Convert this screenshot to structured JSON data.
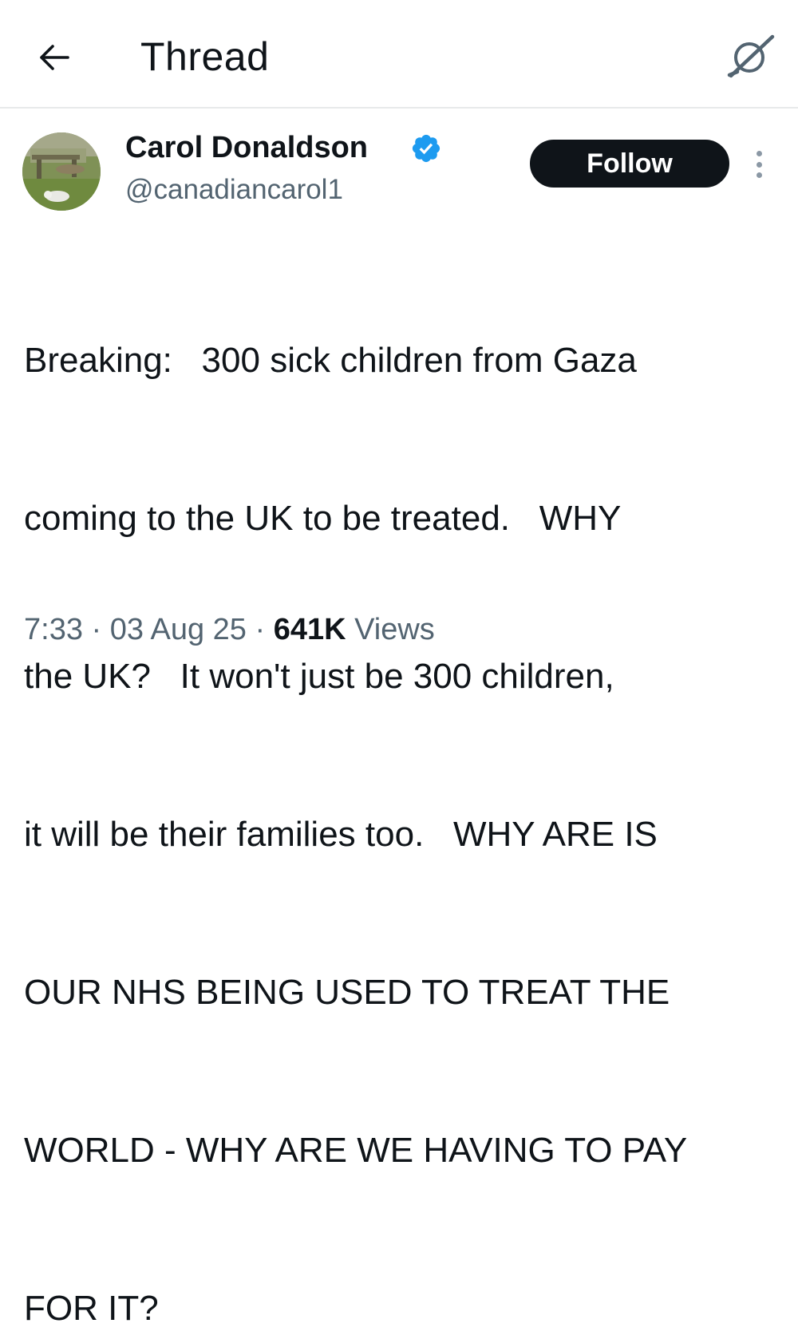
{
  "header": {
    "title": "Thread",
    "back_icon": "arrow-left-icon",
    "grok_icon": "grok-icon"
  },
  "tweet": {
    "author": {
      "display_name": "Carol Donaldson",
      "handle": "@canadiancarol1",
      "verified": true,
      "verified_color": "#1d9bf0"
    },
    "follow_label": "Follow",
    "text_lines": [
      "Breaking:   300 sick children from Gaza",
      "coming to the UK to be treated.   WHY",
      "the UK?   It won't just be 300 children,",
      "it will be their families too.   WHY ARE IS",
      "OUR NHS BEING USED TO TREAT THE",
      "WORLD - WHY ARE WE HAVING TO PAY",
      "FOR IT?"
    ],
    "time": "7:33",
    "separator": " · ",
    "date": "03 Aug 25",
    "views_count": "641K",
    "views_label": " Views"
  },
  "colors": {
    "text_primary": "#0f1419",
    "text_secondary": "#536471",
    "divider": "#e7e9ea",
    "follow_bg": "#0f1419",
    "follow_text": "#ffffff"
  }
}
